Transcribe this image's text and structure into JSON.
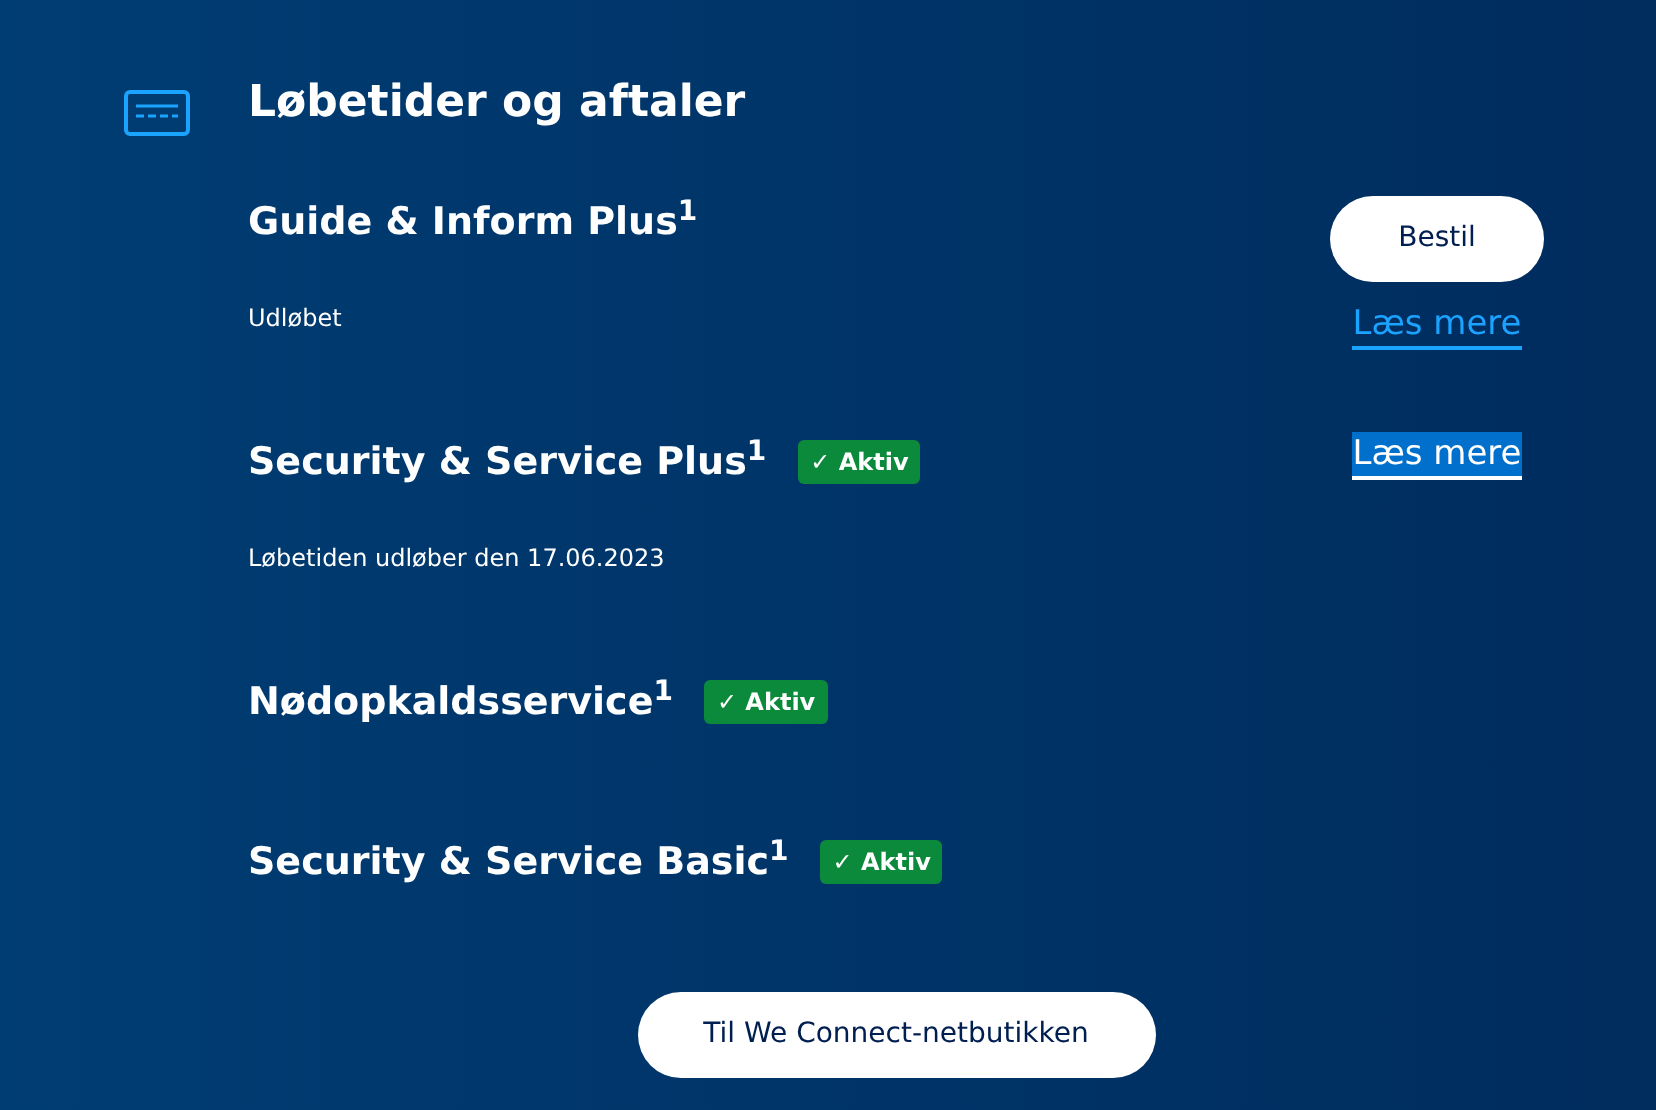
{
  "heading": "Løbetider og aftaler",
  "services": [
    {
      "name": "Guide & Inform Plus",
      "note": "1",
      "status": "Udløbet",
      "actions": [
        {
          "kind": "button",
          "label": "Bestil"
        },
        {
          "kind": "link",
          "label": "Læs mere",
          "focused": false
        }
      ]
    },
    {
      "name": "Security & Service Plus",
      "note": "1",
      "badge": "✓ Aktiv",
      "status": "Løbetiden udløber den 17.06.2023",
      "actions": [
        {
          "kind": "link",
          "label": "Læs mere",
          "focused": true
        }
      ]
    },
    {
      "name": "Nødopkaldsservice",
      "note": "1",
      "badge": "✓ Aktiv"
    },
    {
      "name": "Security & Service Basic",
      "note": "1",
      "badge": "✓ Aktiv"
    }
  ],
  "shop_button": "Til We Connect-netbutikken"
}
